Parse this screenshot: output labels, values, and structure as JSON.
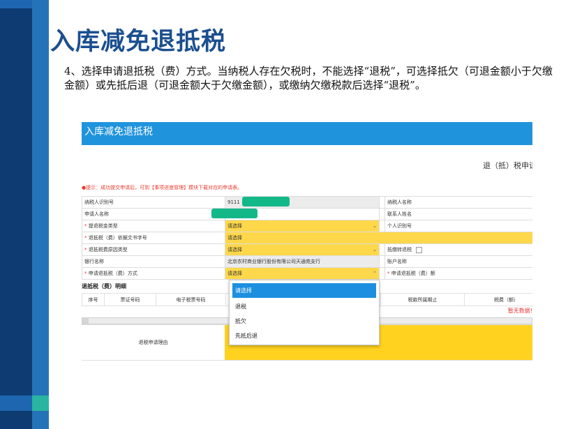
{
  "slide": {
    "title": "入库减免退抵税",
    "text": "4、选择申请退抵税（费）方式。当纳税人存在欠税时，不能选择“退税”，可选择抵欠（可退金额小于欠缴金额）或先抵后退（可退金额大于欠缴金额），或缴纳欠缴税款后选择“退税”。"
  },
  "colors": {
    "sidebar_dark": "#0d3b72",
    "sidebar_mid": "#2473b8",
    "sidebar_accent": "#2ab5a0",
    "title": "#1b4f8f",
    "header": "#2093dd",
    "required_field": "#fed84a",
    "dropdown_selected": "#1c8fe0",
    "hint": "#e63b2e"
  },
  "app": {
    "header_title": "入库减免退抵税",
    "form_caption": "退（抵）税申请",
    "hint": "●提示：成功提交申请后，可到【事项进度管理】模块下载对应的申请表。",
    "required_mark": "*",
    "form": {
      "taxpayer_id_label": "纳税人识别号",
      "taxpayer_id_value": "9111",
      "taxpayer_name_label": "纳税人名称",
      "applicant_name_label": "申请人名称",
      "contact_name_label": "联系人姓名",
      "refund_type_label": "提退税金类型",
      "refund_type_value": "请选择",
      "personal_id_label": "个人识别号",
      "refund_doc_label": "退抵税（费）依据文书字号",
      "refund_doc_value": "请选择",
      "reason_type_label": "退抵税费原因类型",
      "reason_type_value": "请选择",
      "transfer_label": "抵缴转退税",
      "bank_label": "银行名称",
      "bank_value": "北京农村商业银行股份有限公司天通苑支行",
      "account_label": "账户名称",
      "method_label": "申请退抵税（费）方式",
      "method_value": "请选择",
      "amount_label": "申请退抵税（费）额"
    },
    "detail": {
      "title": "退抵税（费）明细",
      "columns": [
        "序号",
        "票证号码",
        "电子税票号码",
        "",
        "税款所属期止",
        "税费（额）"
      ],
      "no_data": "暂无数据!"
    },
    "reason_label": "退税申请理由",
    "dropdown_options": [
      "请选择",
      "退税",
      "抵欠",
      "先抵后退"
    ]
  }
}
